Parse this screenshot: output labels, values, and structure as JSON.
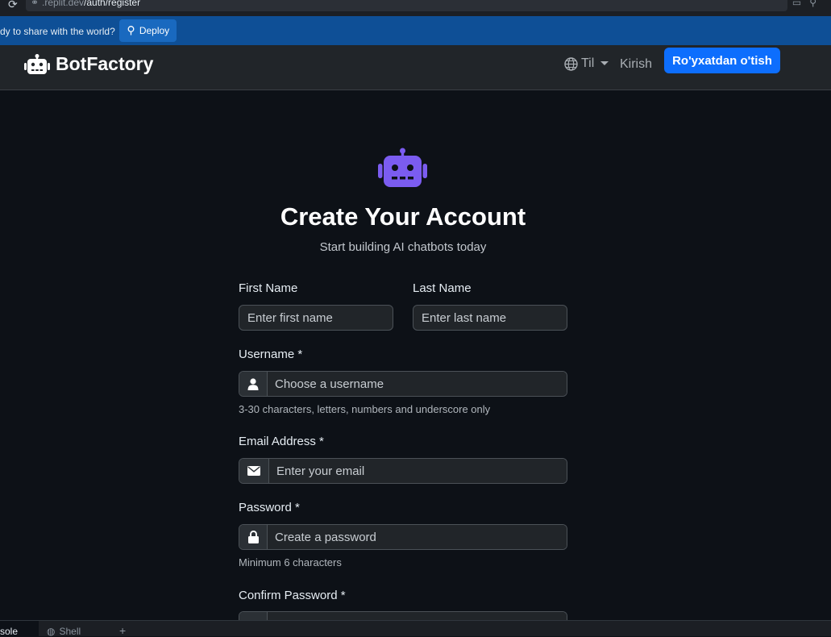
{
  "browser": {
    "url_prefix": ".replit.dev",
    "url_path": "/auth/register"
  },
  "banner": {
    "message": "dy to share with the world?",
    "deploy_label": "Deploy"
  },
  "navbar": {
    "brand": "BotFactory",
    "language_label": "Til",
    "login_label": "Kirish",
    "register_label": "Ro'yxatdan o'tish"
  },
  "page": {
    "title": "Create Your Account",
    "subtitle": "Start building AI chatbots today"
  },
  "form": {
    "first_name": {
      "label": "First Name",
      "placeholder": "Enter first name"
    },
    "last_name": {
      "label": "Last Name",
      "placeholder": "Enter last name"
    },
    "username": {
      "label": "Username *",
      "placeholder": "Choose a username",
      "help": "3-30 characters, letters, numbers and underscore only"
    },
    "email": {
      "label": "Email Address *",
      "placeholder": "Enter your email"
    },
    "password": {
      "label": "Password *",
      "placeholder": "Create a password",
      "help": "Minimum 6 characters"
    },
    "confirm_password": {
      "label": "Confirm Password *"
    }
  },
  "bottom_tabs": {
    "console": "sole",
    "shell": "Shell",
    "add": "+"
  },
  "colors": {
    "accent": "#0d6efd",
    "robot": "#7b5cf0",
    "banner": "#0e4f96"
  }
}
